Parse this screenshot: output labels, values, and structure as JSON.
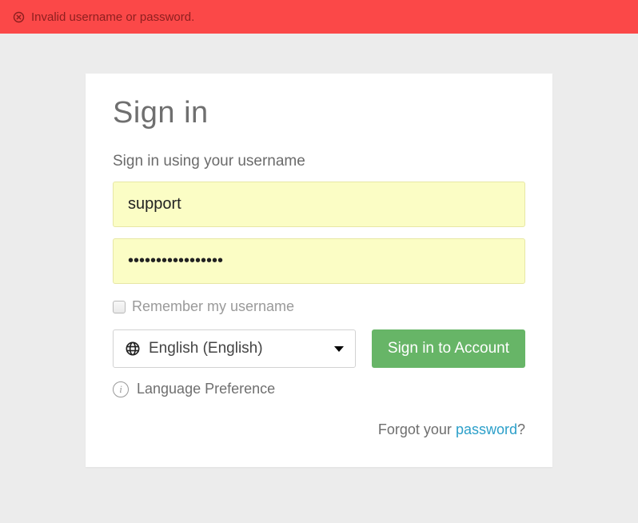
{
  "error": {
    "message": "Invalid username or password."
  },
  "card": {
    "title": "Sign in",
    "subtitle": "Sign in using your username",
    "username_value": "support",
    "password_value": "•••••••••••••••••",
    "remember_label": "Remember my username",
    "language": {
      "selected_label": "English (English)",
      "pref_label": "Language Preference"
    },
    "signin_button_label": "Sign in to Account",
    "forgot": {
      "prefix": "Forgot your ",
      "link": "password",
      "suffix": "?"
    }
  },
  "colors": {
    "error_bg": "#fb4848",
    "input_autofill": "#fbfdc5",
    "btn_primary": "#67b567",
    "link": "#2b9fc9"
  }
}
